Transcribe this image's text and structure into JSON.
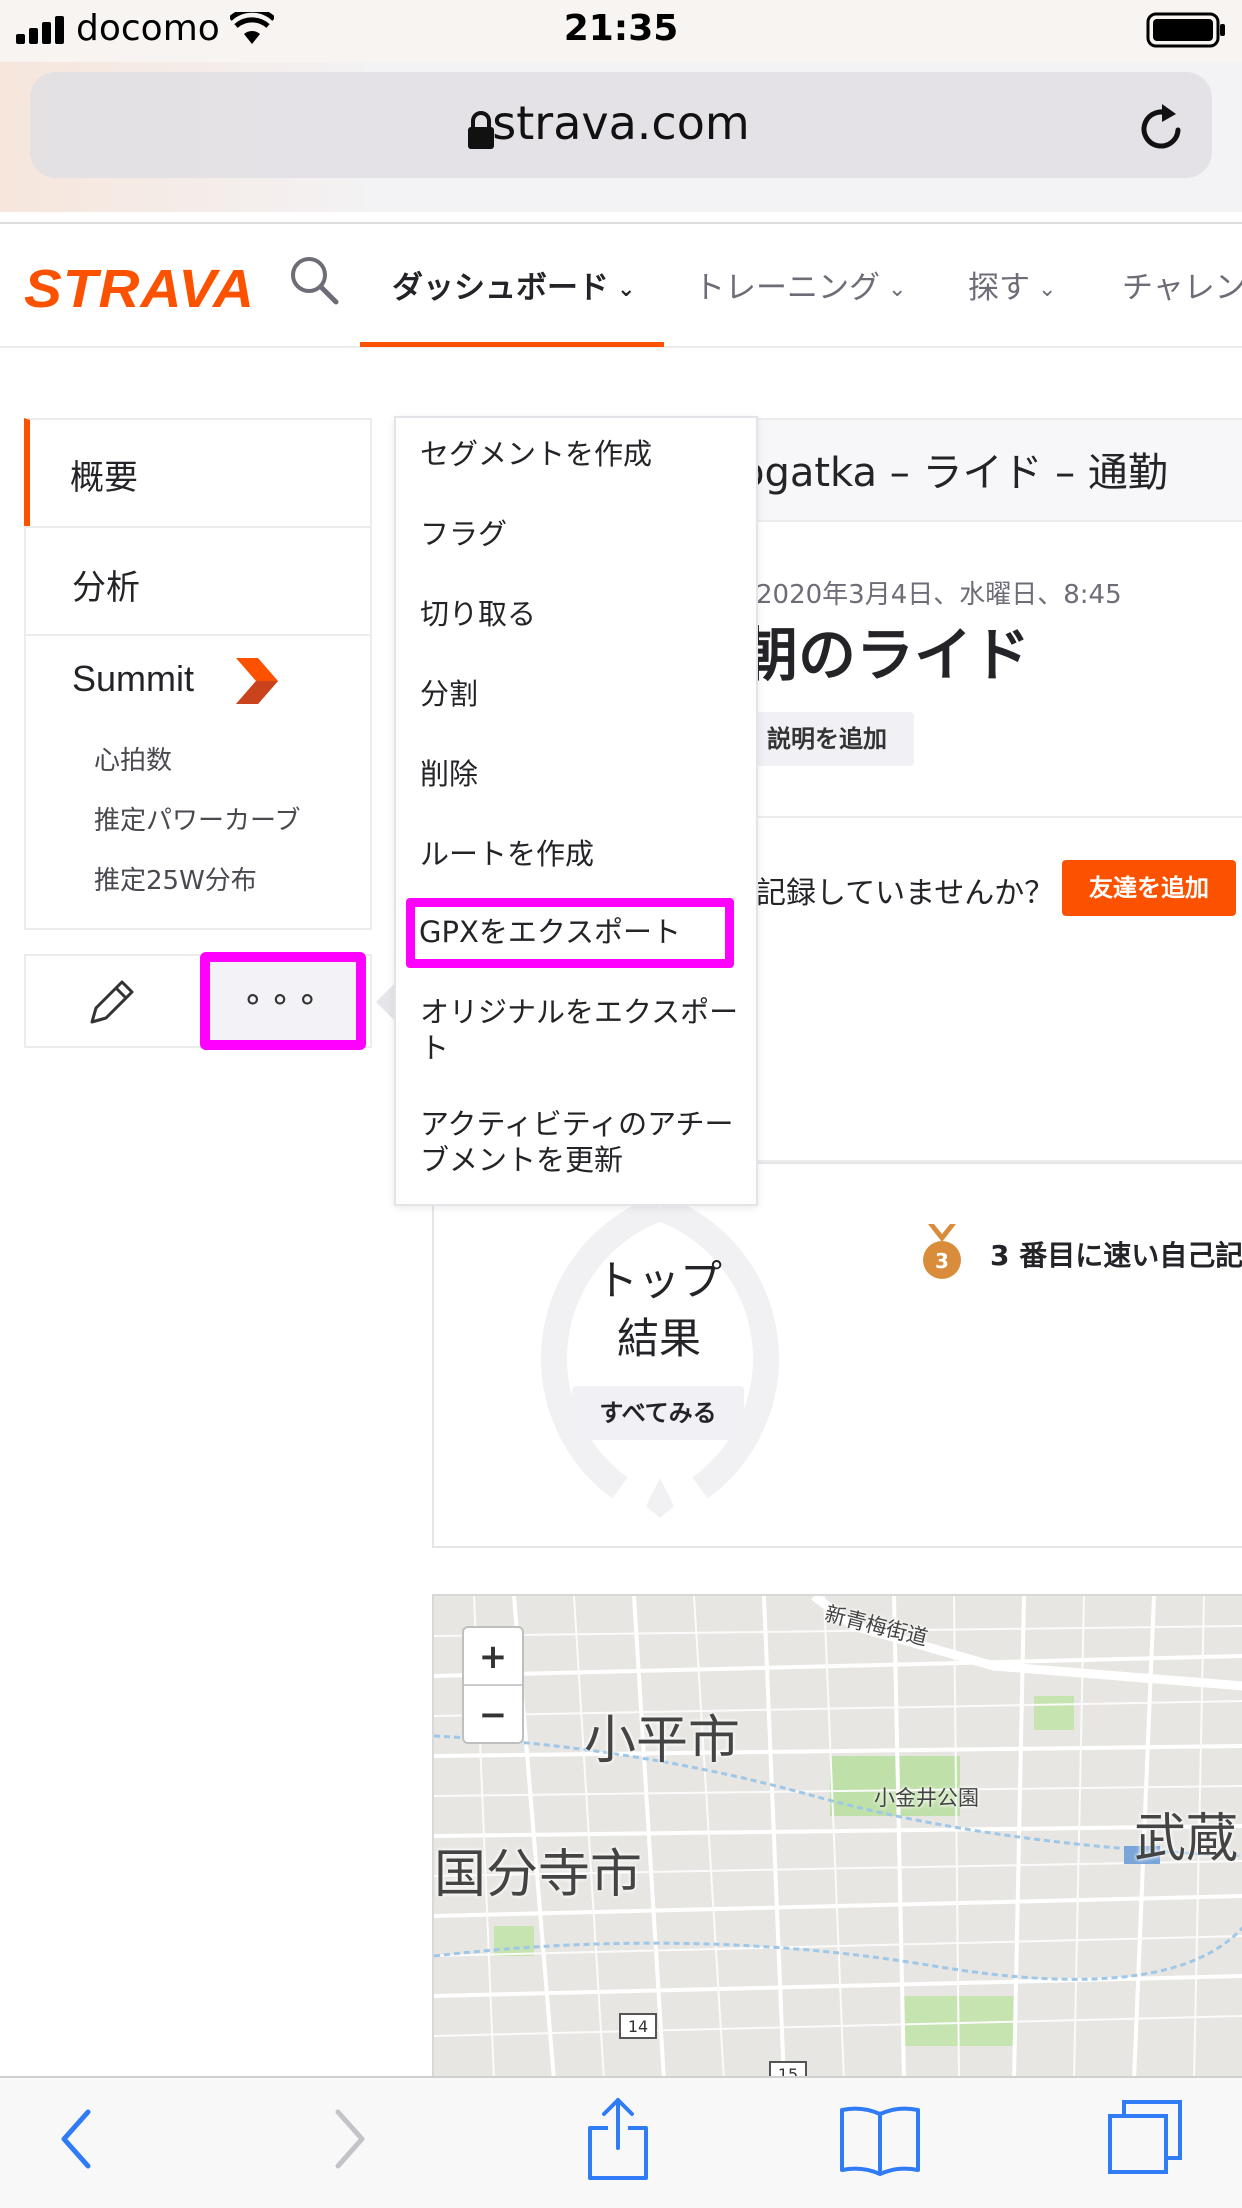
{
  "status_bar": {
    "carrier": "docomo",
    "time": "21:35"
  },
  "browser": {
    "url": "strava.com"
  },
  "nav": {
    "logo": "STRAVA",
    "items": [
      "ダッシュボード",
      "トレーニング",
      "探す",
      "チャレン"
    ],
    "accent_color": "#fc5200"
  },
  "sidebar": {
    "overview": "概要",
    "analysis": "分析",
    "summit": "Summit",
    "summit_items": [
      "心拍数",
      "推定パワーカーブ",
      "推定25W分布"
    ],
    "more_button": "∘∘∘"
  },
  "activity": {
    "header_title": "ogatka – ライド – 通勤",
    "date": "2020年3月4日、水曜日、8:45",
    "name": "朝のライド",
    "add_description": "説明を追加",
    "friends_prompt": "記録していませんか？",
    "add_friend": "友達を追加"
  },
  "results": {
    "label_line1": "トップ",
    "label_line2": "結果",
    "see_all": "すべてみる",
    "medal_number": "3",
    "pr_text": "3 番目に速い自己記"
  },
  "map": {
    "zoom_in": "+",
    "zoom_out": "−",
    "labels": {
      "kodaira": "小平市",
      "kokubunji": "国分寺市",
      "musashi": "武蔵",
      "koganei_park": "小金井公園",
      "shinome_kaido": "新青梅街道"
    },
    "road_numbers": [
      "14",
      "15"
    ]
  },
  "more_menu": {
    "items": [
      "セグメントを作成",
      "フラグ",
      "切り取る",
      "分割",
      "削除",
      "ルートを作成",
      "GPXをエクスポート",
      "オリジナルをエクスポート",
      "アクティビティのアチーブメントを更新"
    ],
    "highlight_color": "#ff00ff"
  }
}
